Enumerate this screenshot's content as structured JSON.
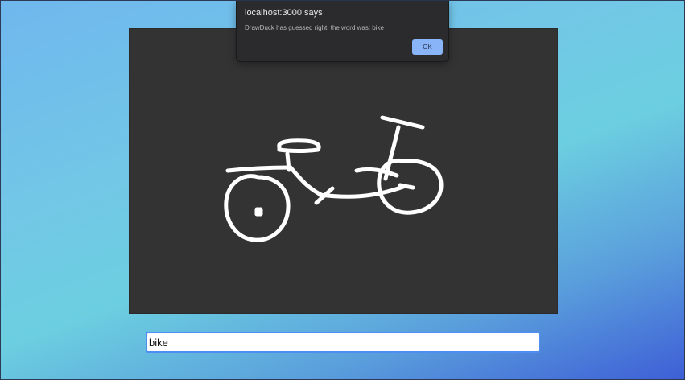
{
  "dialog": {
    "title": "localhost:3000 says",
    "message": "DrawDuck has guessed right, the word was: bike",
    "ok_label": "OK"
  },
  "guess": {
    "value": "bike"
  },
  "colors": {
    "canvas_bg": "#333333",
    "stroke": "#ffffff",
    "dialog_button": "#8ab4f8",
    "input_border": "#4e8ef2"
  }
}
